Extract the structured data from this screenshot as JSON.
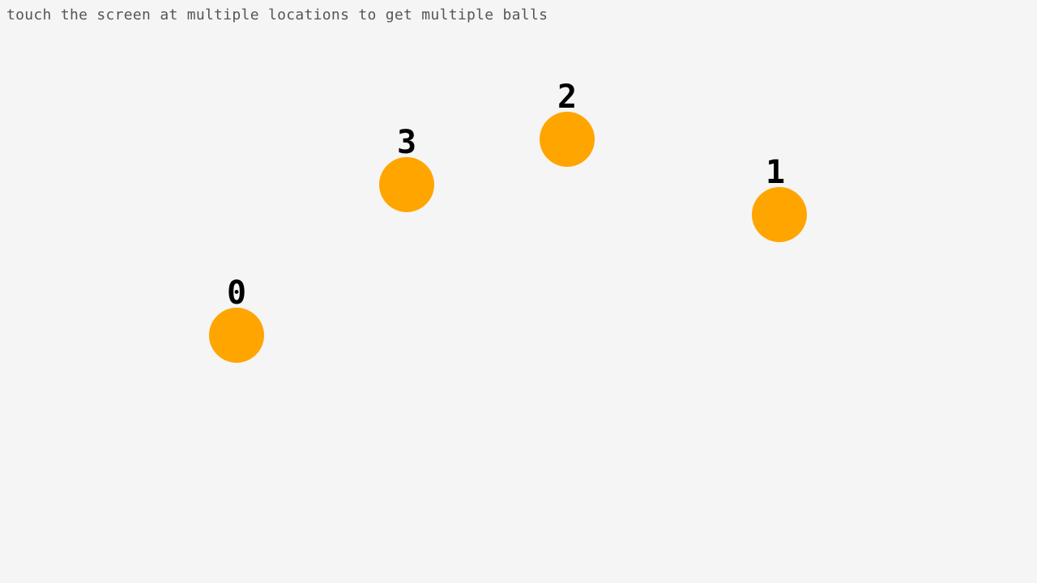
{
  "instruction": "touch the screen at multiple locations to get multiple balls",
  "colors": {
    "background": "#f5f5f5",
    "ball": "#ffa500",
    "label": "#000000",
    "instruction_text": "#555555"
  },
  "balls": [
    {
      "label": "0"
    },
    {
      "label": "1"
    },
    {
      "label": "2"
    },
    {
      "label": "3"
    }
  ]
}
